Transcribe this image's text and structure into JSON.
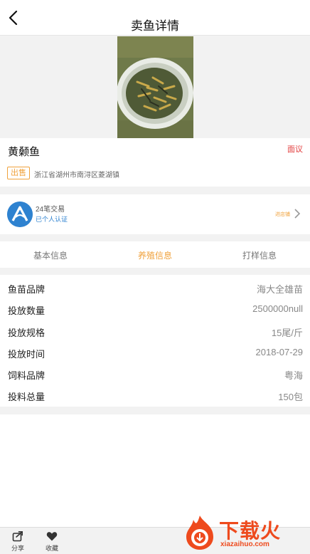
{
  "header": {
    "title": "卖鱼详情"
  },
  "listing": {
    "fish_name": "黄颡鱼",
    "negotiable": "面议",
    "type_tag": "出售",
    "location": "浙江省湖州市南浔区菱湖镇"
  },
  "seller": {
    "trades": "24笔交易",
    "verification": "已个人认证",
    "shop_link": "进店铺"
  },
  "tabs": [
    {
      "label": "基本信息",
      "active": false
    },
    {
      "label": "养殖信息",
      "active": true
    },
    {
      "label": "打样信息",
      "active": false
    }
  ],
  "details": [
    {
      "label": "鱼苗品牌",
      "value": "海大全雄苗"
    },
    {
      "label": "投放数量",
      "value": "2500000null"
    },
    {
      "label": "投放规格",
      "value": "15尾/斤"
    },
    {
      "label": "投放时间",
      "value": "2018-07-29"
    },
    {
      "label": "饲料品牌",
      "value": "粤海"
    },
    {
      "label": "投料总量",
      "value": "150包"
    }
  ],
  "bottom_bar": {
    "share_label": "分享",
    "favorite_label": "收藏"
  },
  "watermark": {
    "brand": "下载火",
    "domain": "xiazaihuo.com"
  },
  "colors": {
    "accent": "#f0a23c",
    "price_red": "#e23c3c",
    "link_blue": "#2e82d0"
  }
}
